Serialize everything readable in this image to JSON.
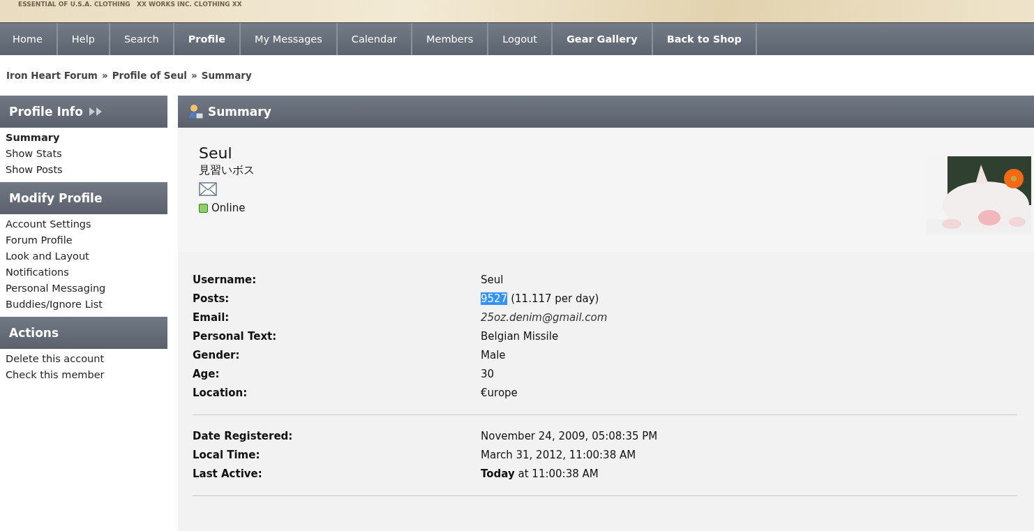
{
  "banner": {
    "tagline": "ESSENTIAL OF U.S.A. CLOTHING   XX WORKS INC. CLOTHING XX"
  },
  "nav": [
    {
      "label": "Home",
      "bold": false
    },
    {
      "label": "Help",
      "bold": false
    },
    {
      "label": "Search",
      "bold": false
    },
    {
      "label": "Profile",
      "bold": true
    },
    {
      "label": "My Messages",
      "bold": false
    },
    {
      "label": "Calendar",
      "bold": false
    },
    {
      "label": "Members",
      "bold": false
    },
    {
      "label": "Logout",
      "bold": false
    },
    {
      "label": "Gear Gallery",
      "bold": true
    },
    {
      "label": "Back to Shop",
      "bold": true
    }
  ],
  "breadcrumb": {
    "separator": "»",
    "links": [
      "Iron Heart Forum",
      "Profile of Seul",
      "Summary"
    ]
  },
  "sidebar": [
    {
      "title": "Profile Info",
      "arrows": true,
      "items": [
        {
          "label": "Summary",
          "selected": true
        },
        {
          "label": "Show Stats",
          "selected": false
        },
        {
          "label": "Show Posts",
          "selected": false
        }
      ]
    },
    {
      "title": "Modify Profile",
      "arrows": false,
      "items": [
        {
          "label": "Account Settings",
          "selected": false
        },
        {
          "label": "Forum Profile",
          "selected": false
        },
        {
          "label": "Look and Layout",
          "selected": false
        },
        {
          "label": "Notifications",
          "selected": false
        },
        {
          "label": "Personal Messaging",
          "selected": false
        },
        {
          "label": "Buddies/Ignore List",
          "selected": false
        }
      ]
    },
    {
      "title": "Actions",
      "arrows": false,
      "items": [
        {
          "label": "Delete this account",
          "selected": false
        },
        {
          "label": "Check this member",
          "selected": false
        }
      ]
    }
  ],
  "summary": {
    "title": "Summary",
    "name": "Seul",
    "rank": "見習いボス",
    "status": {
      "label": "Online",
      "online": true
    }
  },
  "details": [
    [
      {
        "label": "Username:",
        "value": "Seul"
      },
      {
        "label": "Posts:",
        "value": "9527",
        "highlighted": true,
        "extra": "(11.117 per day)"
      },
      {
        "label": "Email:",
        "value": "25oz.denim@gmail.com",
        "kind": "email"
      },
      {
        "label": "Personal Text:",
        "value": "Belgian Missile"
      },
      {
        "label": "Gender:",
        "value": "Male"
      },
      {
        "label": "Age:",
        "value": "30"
      },
      {
        "label": "Location:",
        "value": "€urope"
      }
    ],
    [
      {
        "label": "Date Registered:",
        "value": "November 24, 2009, 05:08:35 PM"
      },
      {
        "label": "Local Time:",
        "value": "March 31, 2012, 11:00:38 AM"
      },
      {
        "label": "Last Active:",
        "value": "**Today** at 11:00:38 AM"
      }
    ]
  ]
}
